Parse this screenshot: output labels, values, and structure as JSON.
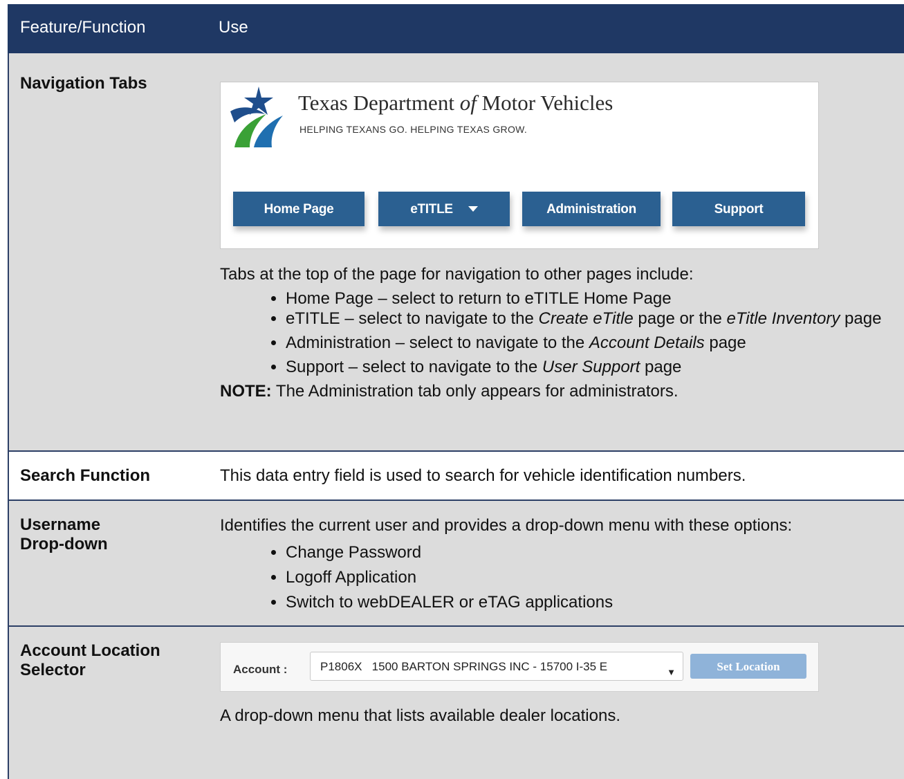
{
  "header": {
    "col1": "Feature/Function",
    "col2": "Use"
  },
  "rows": {
    "nav": {
      "feature": "Navigation Tabs",
      "banner": {
        "org_name_pre": "Texas Department ",
        "org_name_of": "of",
        "org_name_post": " Motor Vehicles",
        "tagline": "HELPING TEXANS GO. HELPING TEXAS GROW.",
        "tabs": [
          "Home Page",
          "eTITLE",
          "Administration",
          "Support"
        ]
      },
      "intro": "Tabs at the top of the page for navigation to other pages include:",
      "bullets": {
        "b1": "Home Page – select to return to eTITLE Home Page",
        "b2_pre": "eTITLE – select to navigate to the ",
        "b2_i1": "Create eTitle",
        "b2_mid": " page or the ",
        "b2_i2": "eTitle Inventory",
        "b2_post": " page",
        "b3_pre": "Administration – select to navigate to the ",
        "b3_i": "Account Details",
        "b3_post": " page",
        "b4_pre": "Support – select to navigate to the ",
        "b4_i": "User Support",
        "b4_post": " page"
      },
      "note_label": "NOTE:",
      "note_text": " The Administration tab only appears for administrators."
    },
    "search": {
      "feature": "Search Function",
      "use": "This data entry field is used to search for vehicle identification numbers."
    },
    "username": {
      "feature_l1": "Username",
      "feature_l2": "Drop-down",
      "intro": "Identifies the current user and provides a drop-down menu with these options:",
      "options": [
        "Change Password",
        "Logoff Application",
        "Switch to webDEALER or eTAG applications"
      ]
    },
    "account": {
      "feature_l1": "Account Location",
      "feature_l2": "Selector",
      "label": "Account :",
      "selected": "P1806X   1500 BARTON SPRINGS INC - 15700 I-35 E",
      "button": "Set Location",
      "use": "A drop-down menu that lists available dealer locations."
    }
  },
  "colors": {
    "header_bg": "#1f3864",
    "tab_bg": "#2b6091",
    "row_gray": "#dcdcdc",
    "set_btn": "#8fb3d9"
  }
}
